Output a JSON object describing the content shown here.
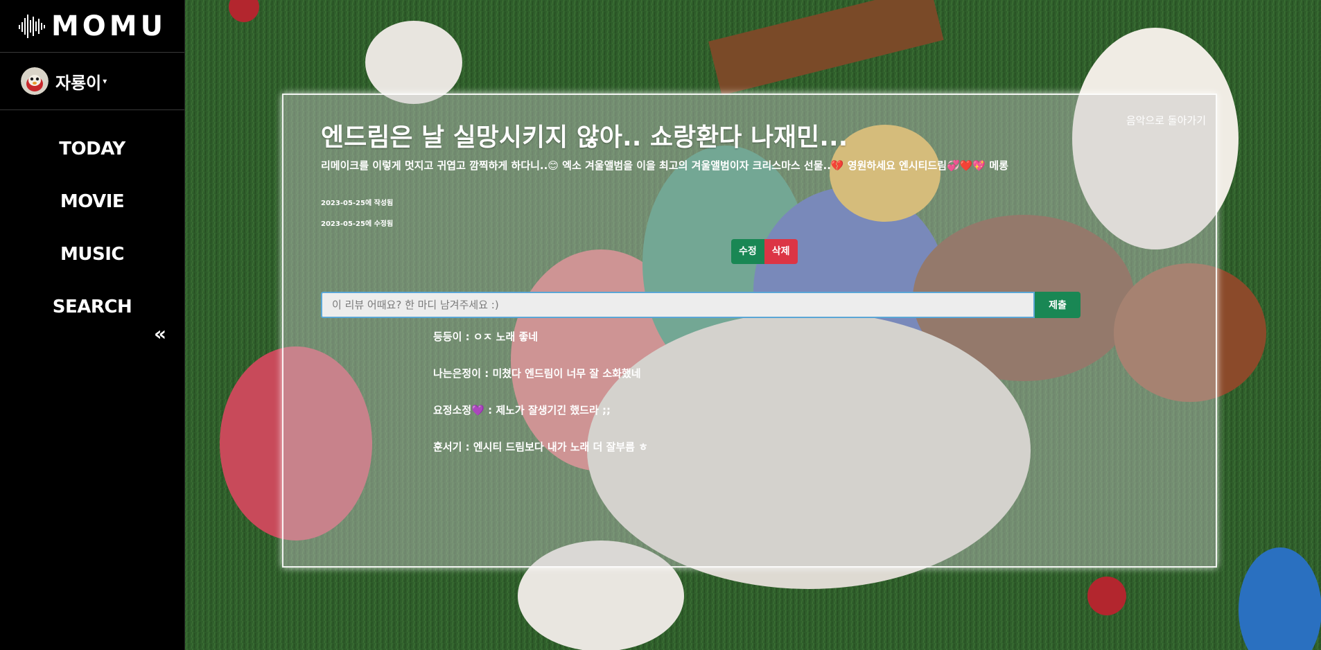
{
  "app": {
    "logo": "MOMU"
  },
  "user": {
    "name": "자룡이",
    "caret": "▾"
  },
  "nav": {
    "items": [
      {
        "label": "TODAY"
      },
      {
        "label": "MOVIE"
      },
      {
        "label": "MUSIC"
      },
      {
        "label": "SEARCH"
      }
    ],
    "collapse": "«"
  },
  "review": {
    "back_link": "음악으로 돌아가기",
    "title": "엔드림은 날 실망시키지 않아.. 쇼랑환다 나재민...",
    "description": "리메이크를 이렇게 멋지고 귀엽고 깜찍하게 하다니..😊 엑소 겨울앨범을 이을 최고의 겨울앨범이자 크리스마스 선물..💔 영원하세요 엔시티드림💞❤️💖 메롱",
    "created": "2023-05-25에 작성됨",
    "updated": "2023-05-25에 수정됨",
    "edit_label": "수정",
    "delete_label": "삭제"
  },
  "comment_form": {
    "placeholder": "이 리뷰 어때요? 한 마디 남겨주세요 :)",
    "submit_label": "제출"
  },
  "comments": [
    {
      "text": "등등이 : ㅇㅈ 노래 좋네"
    },
    {
      "text": "나는은정이 : 미쳤다 엔드림이 너무 잘 소화했네"
    },
    {
      "text": "요정소정💜 : 제노가 잘생기긴 했드라 ;;"
    },
    {
      "text": "훈서기 : 엔시티 드림보다 내가 노래 더 잘부름 ㅎ"
    }
  ],
  "colors": {
    "sidebar_bg": "#000000",
    "edit_button": "#198754",
    "delete_button": "#dc3545",
    "submit_button": "#198754"
  }
}
